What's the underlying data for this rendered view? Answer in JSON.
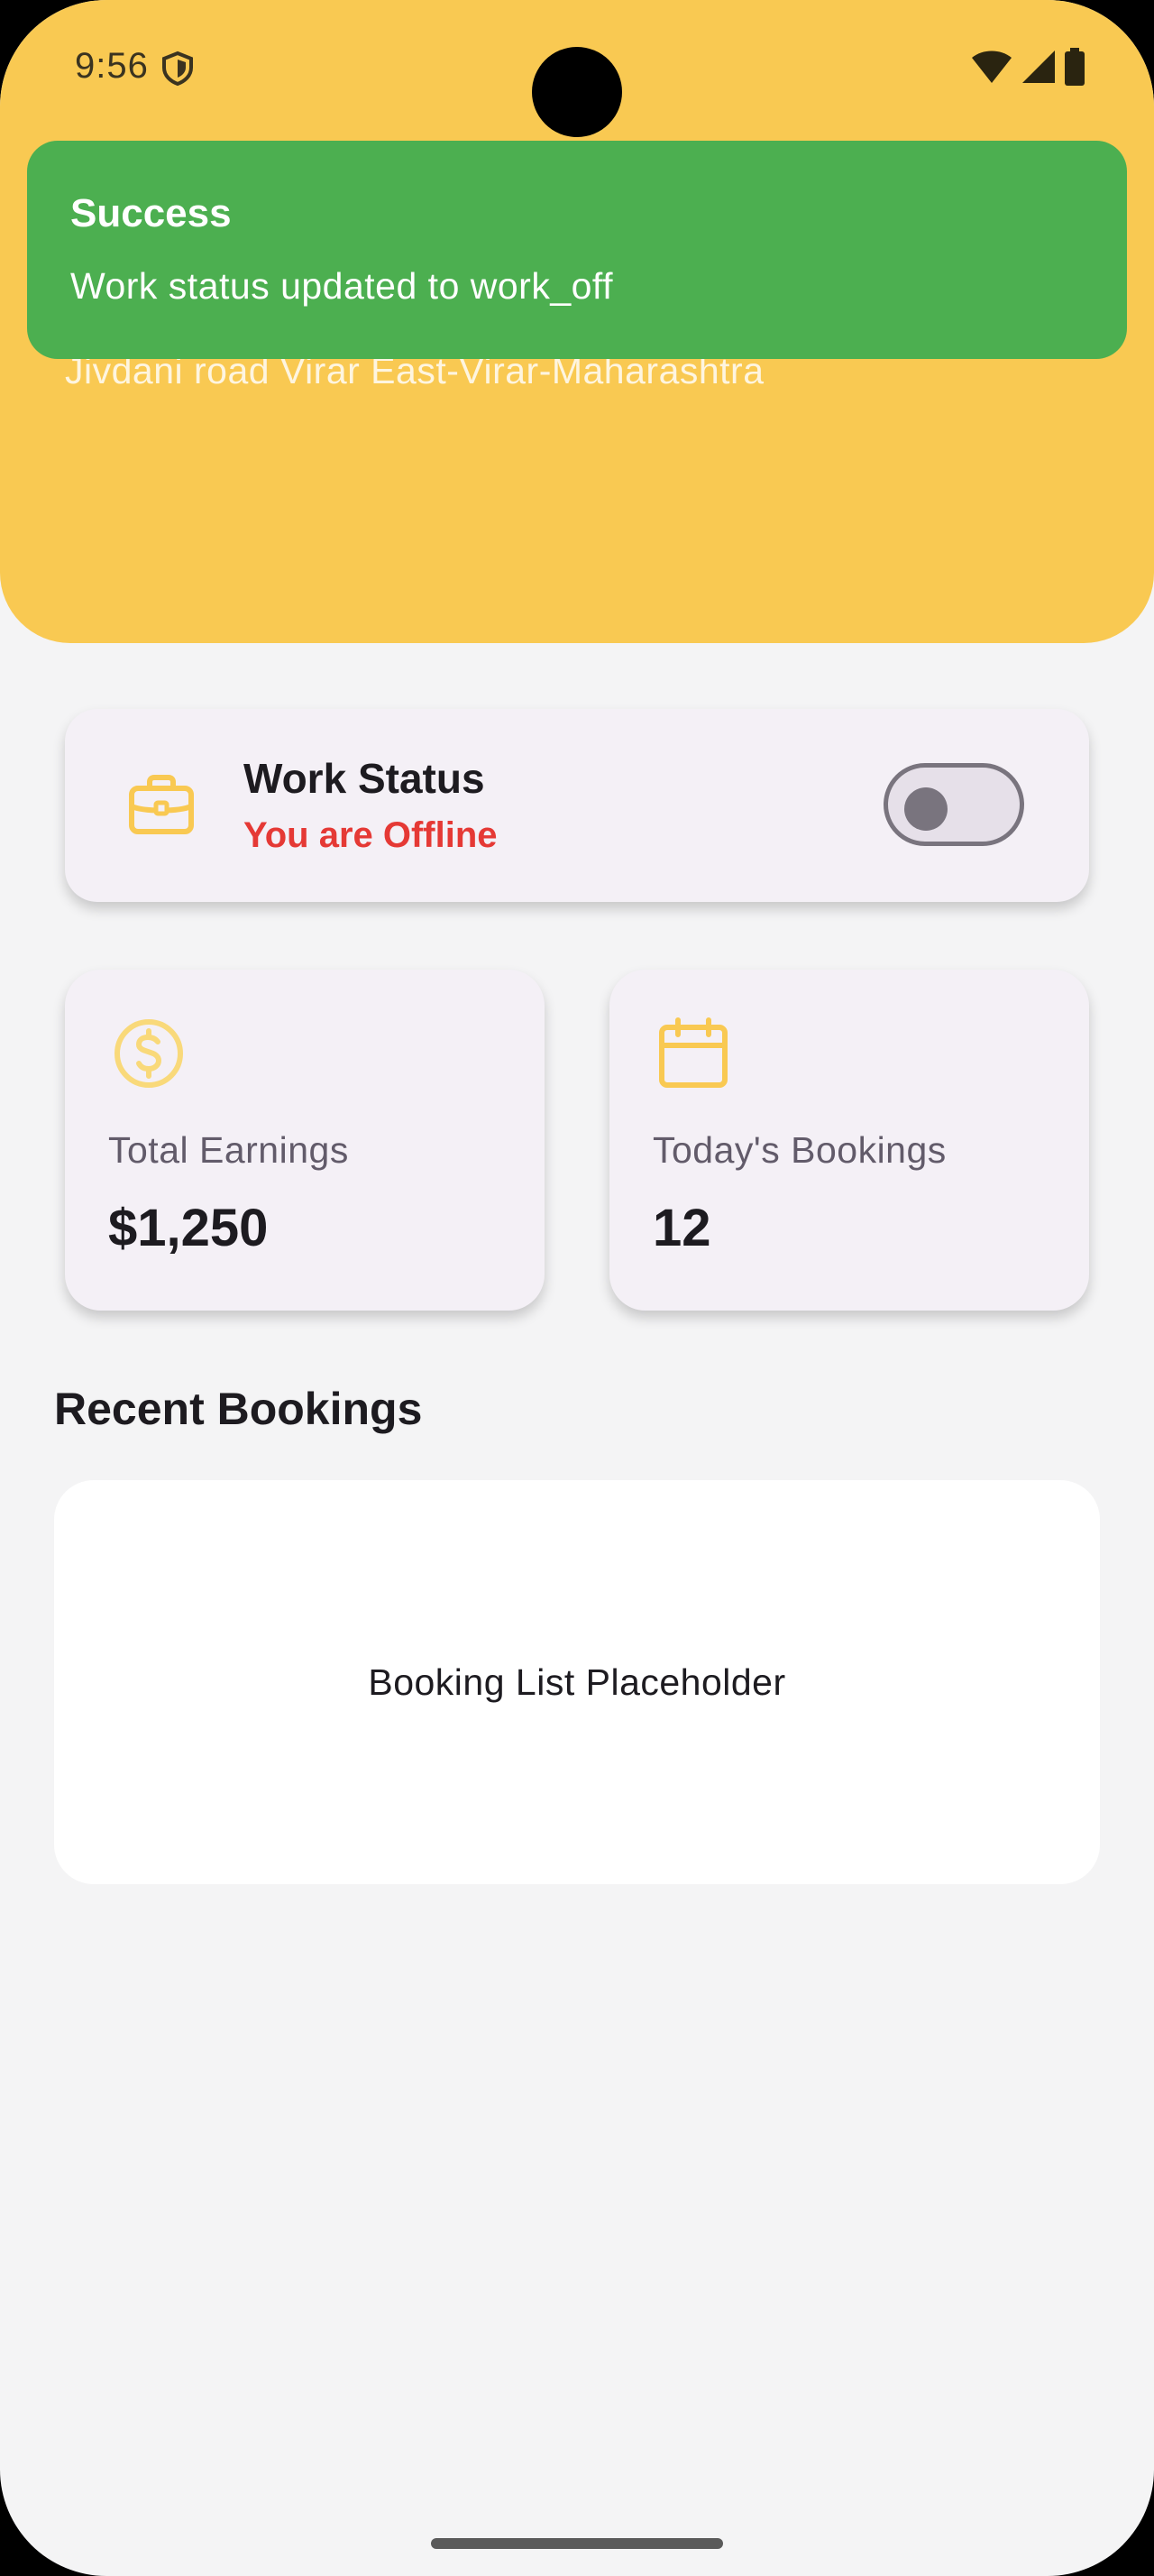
{
  "status_bar": {
    "time": "9:56",
    "icons": [
      "shield-icon",
      "wifi-icon",
      "signal-icon",
      "battery-icon"
    ]
  },
  "header": {
    "address": "Jivdani road Virar East-Virar-Maharashtra",
    "color": "#f9c952"
  },
  "toast": {
    "title": "Success",
    "message": "Work status updated to work_off",
    "color": "#4caf50"
  },
  "work_status": {
    "title": "Work Status",
    "status_text": "You are Offline",
    "icon": "briefcase-icon",
    "toggle_on": false,
    "status_color": "#e53935"
  },
  "stats": [
    {
      "label": "Total Earnings",
      "value": "$1,250",
      "icon": "dollar-icon"
    },
    {
      "label": "Today's Bookings",
      "value": "12",
      "icon": "calendar-icon"
    }
  ],
  "recent_bookings": {
    "title": "Recent Bookings",
    "placeholder": "Booking List Placeholder"
  },
  "colors": {
    "accent": "#f9c952",
    "background": "#f4f4f5",
    "card": "#f4f0f6"
  }
}
